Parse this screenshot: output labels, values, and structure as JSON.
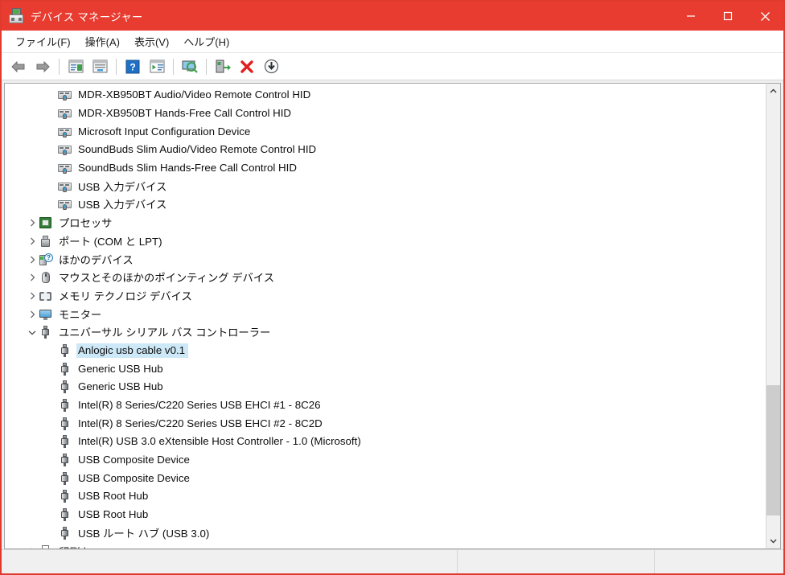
{
  "window": {
    "title": "デバイス マネージャー",
    "title_icon": "device-manager-icon",
    "accent_color": "#e83c30",
    "controls": {
      "minimize": "minimize-button",
      "maximize": "maximize-button",
      "close": "close-button"
    }
  },
  "menubar": {
    "items": [
      {
        "label": "ファイル(F)"
      },
      {
        "label": "操作(A)"
      },
      {
        "label": "表示(V)"
      },
      {
        "label": "ヘルプ(H)"
      }
    ]
  },
  "toolbar": {
    "buttons": [
      {
        "name": "back-icon"
      },
      {
        "name": "forward-icon"
      },
      {
        "name": "separator-1"
      },
      {
        "name": "show-hide-console-tree-icon"
      },
      {
        "name": "properties-icon"
      },
      {
        "name": "separator-2"
      },
      {
        "name": "help-icon"
      },
      {
        "name": "show-hide-action-pane-icon"
      },
      {
        "name": "separator-3"
      },
      {
        "name": "scan-for-hardware-changes-icon"
      },
      {
        "name": "separator-4"
      },
      {
        "name": "update-driver-icon"
      },
      {
        "name": "uninstall-device-icon"
      },
      {
        "name": "disable-device-icon"
      }
    ]
  },
  "tree": {
    "rows": [
      {
        "label": "MDR-XB950BT Audio/Video Remote Control HID",
        "icon": "hid-device-icon",
        "indent": "indent-2-noc",
        "chevron": "",
        "selected": false
      },
      {
        "label": "MDR-XB950BT Hands-Free Call Control HID",
        "icon": "hid-device-icon",
        "indent": "indent-2-noc",
        "chevron": "",
        "selected": false
      },
      {
        "label": "Microsoft Input Configuration Device",
        "icon": "hid-device-icon",
        "indent": "indent-2-noc",
        "chevron": "",
        "selected": false
      },
      {
        "label": "SoundBuds Slim Audio/Video Remote Control HID",
        "icon": "hid-device-icon",
        "indent": "indent-2-noc",
        "chevron": "",
        "selected": false
      },
      {
        "label": "SoundBuds Slim Hands-Free Call Control HID",
        "icon": "hid-device-icon",
        "indent": "indent-2-noc",
        "chevron": "",
        "selected": false
      },
      {
        "label": "USB 入力デバイス",
        "icon": "hid-device-icon",
        "indent": "indent-2-noc",
        "chevron": "",
        "selected": false
      },
      {
        "label": "USB 入力デバイス",
        "icon": "hid-device-icon",
        "indent": "indent-2-noc",
        "chevron": "",
        "selected": false
      },
      {
        "label": "プロセッサ",
        "icon": "processor-icon",
        "indent": "indent-1",
        "chevron": "collapsed",
        "selected": false
      },
      {
        "label": "ポート (COM と LPT)",
        "icon": "port-icon",
        "indent": "indent-1",
        "chevron": "collapsed",
        "selected": false
      },
      {
        "label": "ほかのデバイス",
        "icon": "other-device-icon",
        "indent": "indent-1",
        "chevron": "collapsed",
        "selected": false
      },
      {
        "label": "マウスとそのほかのポインティング デバイス",
        "icon": "mouse-icon",
        "indent": "indent-1",
        "chevron": "collapsed",
        "selected": false
      },
      {
        "label": "メモリ テクノロジ デバイス",
        "icon": "memory-device-icon",
        "indent": "indent-1",
        "chevron": "collapsed",
        "selected": false
      },
      {
        "label": "モニター",
        "icon": "monitor-icon",
        "indent": "indent-1",
        "chevron": "collapsed",
        "selected": false
      },
      {
        "label": "ユニバーサル シリアル バス コントローラー",
        "icon": "usb-icon",
        "indent": "indent-1",
        "chevron": "expanded",
        "selected": false
      },
      {
        "label": "Anlogic usb cable v0.1",
        "icon": "usb-icon",
        "indent": "indent-2-noc",
        "chevron": "",
        "selected": true
      },
      {
        "label": "Generic USB Hub",
        "icon": "usb-icon",
        "indent": "indent-2-noc",
        "chevron": "",
        "selected": false
      },
      {
        "label": "Generic USB Hub",
        "icon": "usb-icon",
        "indent": "indent-2-noc",
        "chevron": "",
        "selected": false
      },
      {
        "label": "Intel(R) 8 Series/C220 Series USB EHCI #1 - 8C26",
        "icon": "usb-icon",
        "indent": "indent-2-noc",
        "chevron": "",
        "selected": false
      },
      {
        "label": "Intel(R) 8 Series/C220 Series USB EHCI #2 - 8C2D",
        "icon": "usb-icon",
        "indent": "indent-2-noc",
        "chevron": "",
        "selected": false
      },
      {
        "label": "Intel(R) USB 3.0 eXtensible Host Controller - 1.0 (Microsoft)",
        "icon": "usb-icon",
        "indent": "indent-2-noc",
        "chevron": "",
        "selected": false
      },
      {
        "label": "USB Composite Device",
        "icon": "usb-icon",
        "indent": "indent-2-noc",
        "chevron": "",
        "selected": false
      },
      {
        "label": "USB Composite Device",
        "icon": "usb-icon",
        "indent": "indent-2-noc",
        "chevron": "",
        "selected": false
      },
      {
        "label": "USB Root Hub",
        "icon": "usb-icon",
        "indent": "indent-2-noc",
        "chevron": "",
        "selected": false
      },
      {
        "label": "USB Root Hub",
        "icon": "usb-icon",
        "indent": "indent-2-noc",
        "chevron": "",
        "selected": false
      },
      {
        "label": "USB ルート ハブ (USB 3.0)",
        "icon": "usb-icon",
        "indent": "indent-2-noc",
        "chevron": "",
        "selected": false
      },
      {
        "label": "印刷キュー",
        "icon": "print-queue-icon",
        "indent": "indent-1",
        "chevron": "collapsed",
        "selected": false
      }
    ],
    "selection": "Anlogic usb cable v0.1",
    "selection_color": "#cde8f7"
  },
  "scrollbar": {
    "up_arrow": "scroll-up-arrow",
    "down_arrow": "scroll-down-arrow",
    "thumb_top_pct": 66,
    "thumb_height_pct": 30
  },
  "statusbar": {
    "cells": [
      "",
      "",
      ""
    ]
  }
}
